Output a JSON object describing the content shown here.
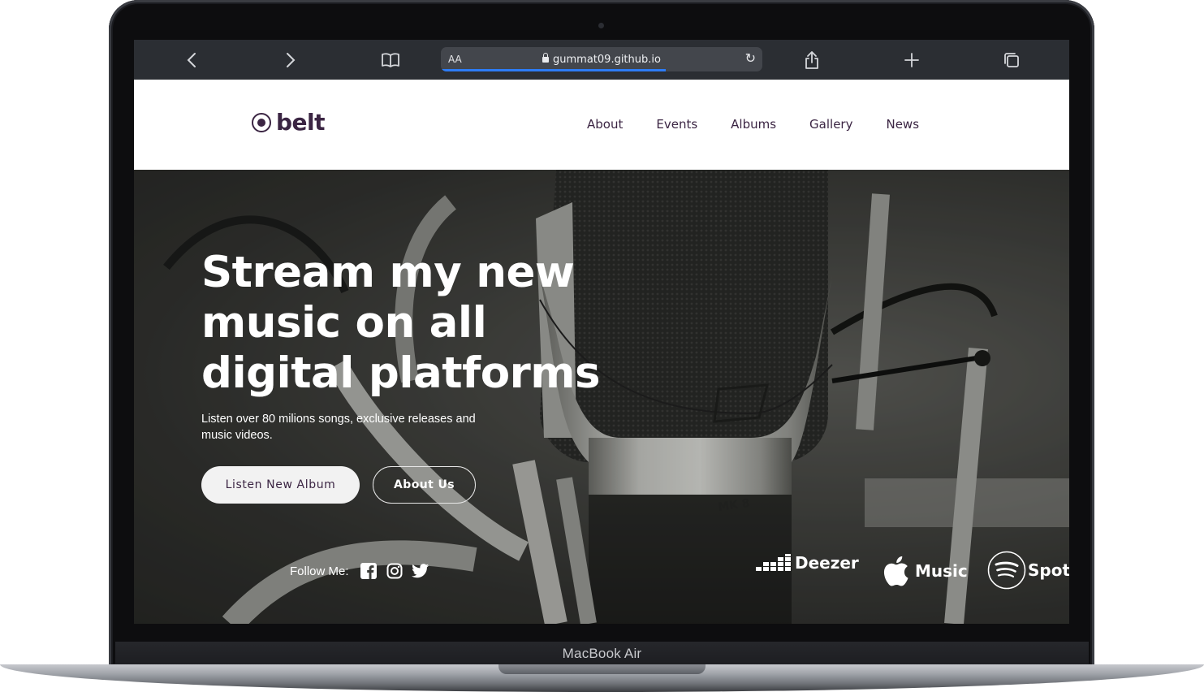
{
  "device": {
    "label": "MacBook Air"
  },
  "browser": {
    "text_size_label": "AA",
    "url": "gummat09.github.io",
    "load_progress": 0.7,
    "icons": [
      "chevron-left-icon",
      "chevron-right-icon",
      "book-icon",
      "lock-icon",
      "reload-icon",
      "share-icon",
      "plus-icon",
      "tabs-icon"
    ]
  },
  "site": {
    "logo": "belt",
    "nav": [
      "About",
      "Events",
      "Albums",
      "Gallery",
      "News"
    ]
  },
  "hero": {
    "title_lines": [
      "Stream my new",
      "music on all",
      "digital platforms"
    ],
    "subtitle_lines": [
      "Listen over 80 milions songs, exclusive releases and",
      "music videos."
    ],
    "primary_button": "Listen New Album",
    "secondary_button": "About Us",
    "follow_label": "Follow Me:",
    "social": [
      "facebook-icon",
      "instagram-icon",
      "twitter-icon"
    ],
    "platforms": [
      "Deezer",
      "Music",
      "Spoti"
    ]
  },
  "colors": {
    "brand": "#3b2543",
    "toolbar": "#2b2e33",
    "accent": "#2d7cf6"
  }
}
